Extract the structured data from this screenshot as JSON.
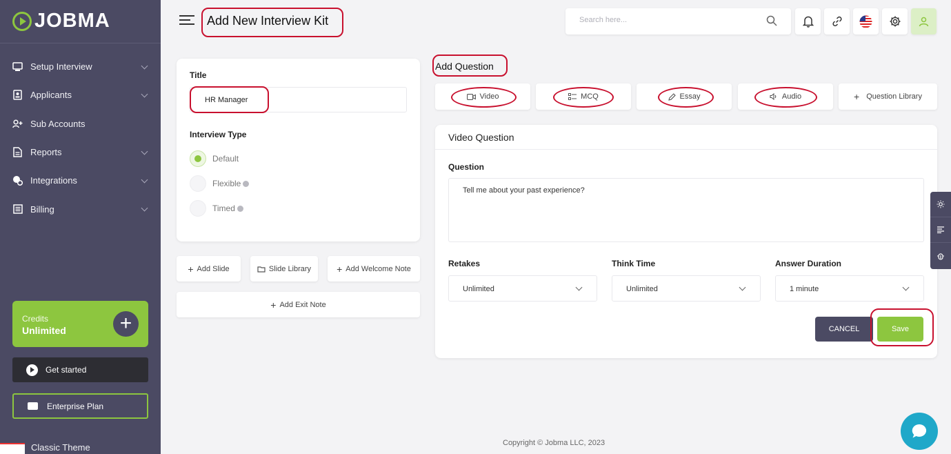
{
  "brand": {
    "name": "JOBMA"
  },
  "sidebar": {
    "items": [
      {
        "label": "Setup Interview",
        "icon": "setup-interview-icon"
      },
      {
        "label": "Applicants",
        "icon": "applicants-icon"
      },
      {
        "label": "Sub Accounts",
        "icon": "sub-accounts-icon"
      },
      {
        "label": "Reports",
        "icon": "reports-icon"
      },
      {
        "label": "Integrations",
        "icon": "integrations-icon"
      },
      {
        "label": "Billing",
        "icon": "billing-icon"
      }
    ],
    "credits_label": "Credits",
    "credits_value": "Unlimited",
    "get_started": "Get started",
    "enterprise_plan": "Enterprise Plan",
    "classic_theme": "Classic Theme"
  },
  "header": {
    "page_title": "Add New Interview Kit",
    "search_placeholder": "Search here..."
  },
  "kit": {
    "title_label": "Title",
    "title_value": "HR Manager",
    "interview_type_label": "Interview Type",
    "interview_types": [
      {
        "label": "Default",
        "selected": true
      },
      {
        "label": "Flexible",
        "selected": false
      },
      {
        "label": "Timed",
        "selected": false
      }
    ],
    "add_slide": "Add Slide",
    "slide_library": "Slide Library",
    "add_welcome_note": "Add Welcome Note",
    "add_exit_note": "Add Exit Note"
  },
  "add_question": {
    "title": "Add Question",
    "types": [
      "Video",
      "MCQ",
      "Essay",
      "Audio",
      "Question Library"
    ]
  },
  "video_question": {
    "heading": "Video Question",
    "question_label": "Question",
    "question_value": "Tell me about your past experience?",
    "retakes_label": "Retakes",
    "retakes_value": "Unlimited",
    "think_time_label": "Think Time",
    "think_time_value": "Unlimited",
    "answer_duration_label": "Answer Duration",
    "answer_duration_value": "1 minute",
    "cancel": "CANCEL",
    "save": "Save"
  },
  "footer": {
    "copyright": "Copyright © Jobma LLC, 2023"
  },
  "colors": {
    "sidebar": "#4b4a63",
    "accent": "#8dc63f",
    "annotation": "#c8102e",
    "chat": "#1fa8c9"
  }
}
